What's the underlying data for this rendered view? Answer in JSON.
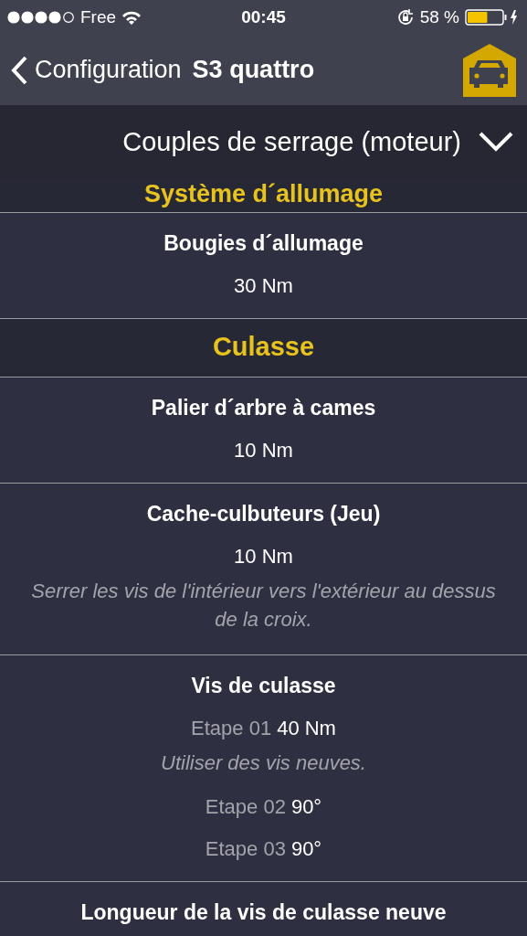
{
  "status_bar": {
    "carrier": "Free",
    "time": "00:45",
    "battery_text": "58 %",
    "level": 0.58
  },
  "nav": {
    "back": "Configuration",
    "title": "S3 quattro"
  },
  "dropdown": {
    "label": "Couples de serrage (moteur)"
  },
  "rows": [
    {
      "kind": "section",
      "title": "Système d´allumage"
    },
    {
      "kind": "item",
      "title": "Bougies d´allumage",
      "lines": [
        {
          "kind": "value",
          "text": "30 Nm"
        }
      ]
    },
    {
      "kind": "section",
      "title": "Culasse"
    },
    {
      "kind": "item",
      "title": "Palier d´arbre à cames",
      "lines": [
        {
          "kind": "value",
          "text": "10 Nm"
        }
      ]
    },
    {
      "kind": "item",
      "title": "Cache-culbuteurs (Jeu)",
      "lines": [
        {
          "kind": "value",
          "text": "10 Nm"
        },
        {
          "kind": "note",
          "text": "Serrer les vis de l'intérieur vers l'extérieur au dessus de la croix."
        }
      ]
    },
    {
      "kind": "item",
      "title": "Vis de culasse",
      "lines": [
        {
          "kind": "step",
          "step": "Etape 01",
          "text": "40 Nm"
        },
        {
          "kind": "note",
          "text": "Utiliser des vis neuves."
        },
        {
          "kind": "step",
          "step": "Etape 02",
          "text": "90°"
        },
        {
          "kind": "step",
          "step": "Etape 03",
          "text": "90°"
        }
      ]
    },
    {
      "kind": "item",
      "title": "Longueur de la vis de culasse neuve",
      "lines": []
    }
  ]
}
